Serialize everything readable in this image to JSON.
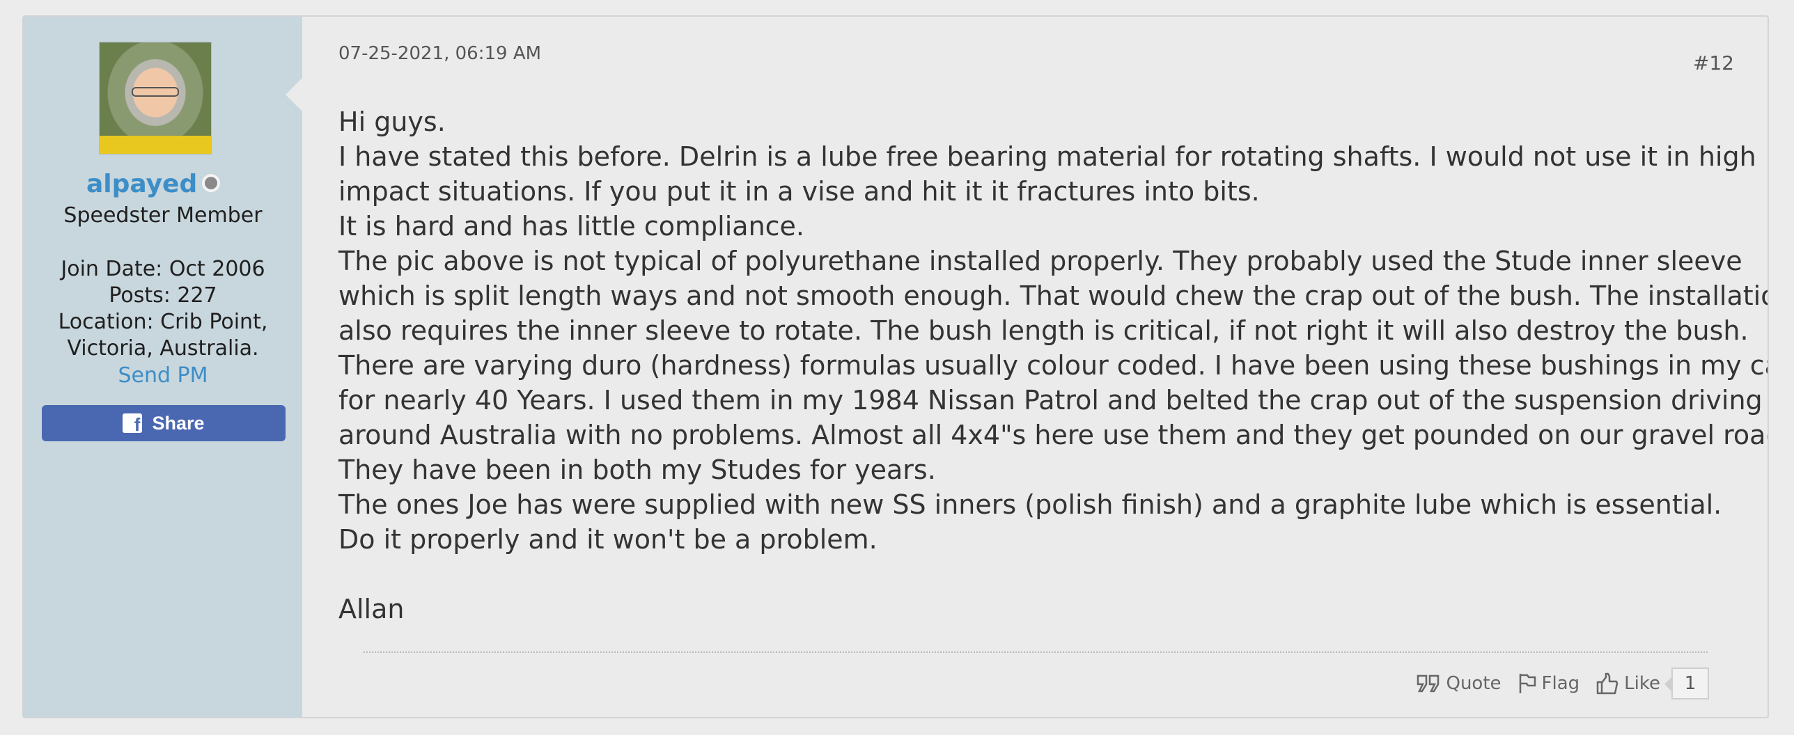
{
  "user": {
    "name": "alpayed",
    "title": "Speedster Member",
    "join_date": "Join Date: Oct 2006",
    "posts": "Posts: 227",
    "location_line1": "Location: Crib Point,",
    "location_line2": "Victoria, Australia.",
    "send_pm": "Send PM",
    "share_label": "Share",
    "status": "offline"
  },
  "post": {
    "date": "07-25-2021, 06:19 AM",
    "number": "#12",
    "lines": [
      "Hi guys.",
      "I have stated this before. Delrin is a lube free bearing material for rotating shafts. I would not use it in high",
      "impact situations. If you put it in a vise and hit it it fractures into bits.",
      "It is hard and has little compliance.",
      "The pic above is not typical of polyurethane installed properly. They probably used the Stude inner sleeve",
      "which is split length ways and not smooth enough. That would chew the crap out of the bush. The installation",
      "also requires the inner sleeve to rotate. The bush length is critical, if not right it will also destroy the bush.",
      "There are varying duro (hardness) formulas usually colour coded. I have been using these bushings in my cars",
      "for nearly 40 Years. I used them in my 1984 Nissan Patrol and belted the crap out of the suspension driving",
      "around Australia with no problems. Almost all 4x4\"s here use them and they get pounded on our gravel roads.",
      "They have been in both my Studes for years.",
      "The ones Joe has were supplied with new SS inners (polish finish) and a graphite lube which is essential.",
      "Do it properly and it won't be a problem."
    ],
    "signature": "Allan"
  },
  "actions": {
    "quote": "Quote",
    "flag": "Flag",
    "like": "Like",
    "like_count": "1"
  },
  "colors": {
    "sidebar_bg": "#c8d6dd",
    "username": "#3d8ec7",
    "share_button": "#4a68b2",
    "page_bg": "#ebebeb"
  }
}
